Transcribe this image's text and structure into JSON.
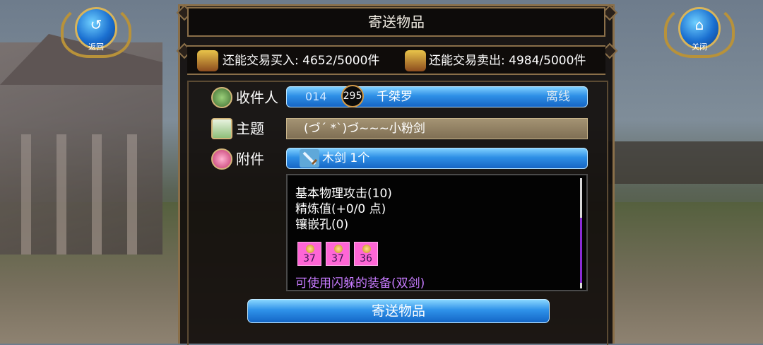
{
  "window": {
    "title": "寄送物品"
  },
  "top_left_button": {
    "label": "返回",
    "icon": "return-arrow-icon"
  },
  "top_right_button": {
    "label": "关闭",
    "icon": "home-icon"
  },
  "trade_limits": {
    "buy_label": "还能交易买入:",
    "buy_value": "4652/5000件",
    "sell_label": "还能交易卖出:",
    "sell_value": "4984/5000件"
  },
  "recipient": {
    "label": "收件人",
    "id": "014",
    "level": "295",
    "name": "千桀罗",
    "status": "离线"
  },
  "subject": {
    "label": "主题",
    "value": "(づ´ *`)づ~~~小粉剑"
  },
  "attachment": {
    "label": "附件",
    "item": "木剑 1个"
  },
  "item_details": {
    "lines": [
      "基本物理攻击(10)",
      "精炼值(+0/0 点)",
      "镶嵌孔(0)"
    ],
    "gems": [
      "37",
      "37",
      "36"
    ],
    "usable": "可使用闪躲的装备(双剑)"
  },
  "send_button": {
    "label": "寄送物品"
  },
  "colors": {
    "accent_blue": "#2e8fe6",
    "frame_brown": "#8a6f49",
    "gem_pink": "#ff66d6",
    "usable_purple": "#c77bff"
  }
}
